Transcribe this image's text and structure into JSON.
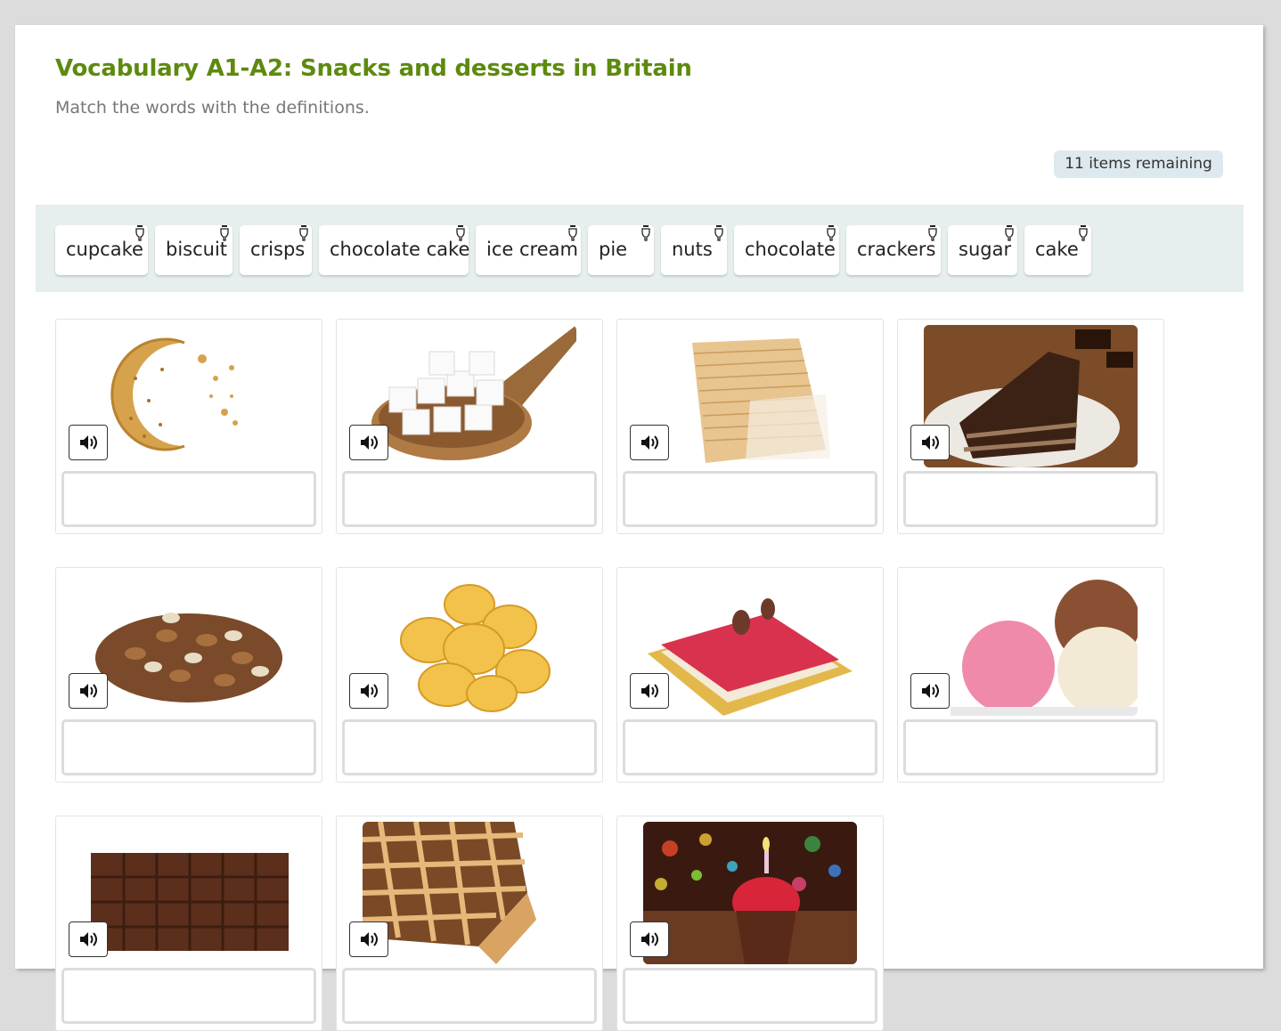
{
  "header": {
    "title": "Vocabulary A1-A2: Snacks and desserts in Britain",
    "subtitle": "Match the words with the definitions.",
    "remaining": "11 items remaining"
  },
  "word_bank": [
    {
      "label": "cupcake"
    },
    {
      "label": "biscuit"
    },
    {
      "label": "crisps"
    },
    {
      "label": "chocolate cake"
    },
    {
      "label": "ice cream"
    },
    {
      "label": "pie"
    },
    {
      "label": "nuts"
    },
    {
      "label": "chocolate"
    },
    {
      "label": "crackers"
    },
    {
      "label": "sugar"
    },
    {
      "label": "cake"
    }
  ],
  "cards": [
    {
      "picture": "biscuit-icon"
    },
    {
      "picture": "sugar-icon"
    },
    {
      "picture": "crackers-icon"
    },
    {
      "picture": "chocolate-cake-icon"
    },
    {
      "picture": "nuts-icon"
    },
    {
      "picture": "crisps-icon"
    },
    {
      "picture": "cake-icon"
    },
    {
      "picture": "ice-cream-icon"
    },
    {
      "picture": "chocolate-icon"
    },
    {
      "picture": "pie-icon"
    },
    {
      "picture": "cupcake-icon"
    }
  ],
  "colors": {
    "title": "#5d8a0e",
    "bank_bg": "#e6eeee",
    "badge_bg": "#dde9ef"
  }
}
